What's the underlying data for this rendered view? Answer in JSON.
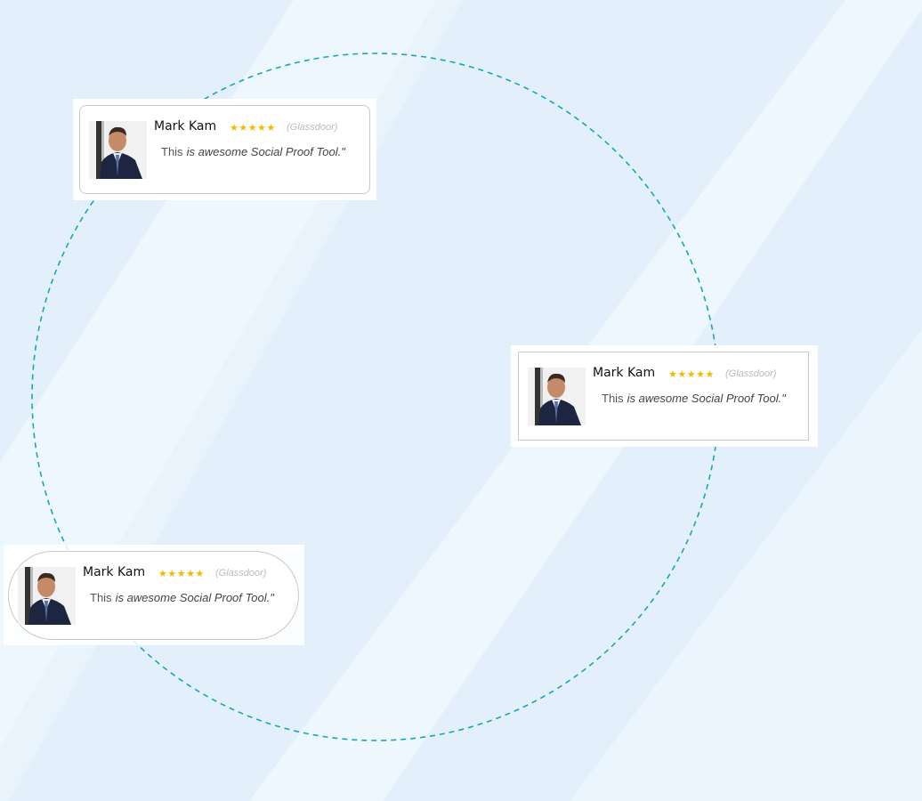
{
  "colors": {
    "background": "#e3f0fb",
    "background_stripe": "#eef7fd",
    "orbit_line": "#14a8b4",
    "star": "#f5b800",
    "source_text": "#bbbbbb"
  },
  "testimonials": [
    {
      "name": "Mark Kam",
      "stars": "★★★★★",
      "rating": 5,
      "source": "(Glassdoor)",
      "quote_lead": "This",
      "quote_rest": "is awesome Social Proof Tool.\"",
      "style": "rounded-rectangle"
    },
    {
      "name": "Mark Kam",
      "stars": "★★★★★",
      "rating": 5,
      "source": "(Glassdoor)",
      "quote_lead": "This",
      "quote_rest": "is awesome Social Proof Tool.\"",
      "style": "square-rectangle"
    },
    {
      "name": "Mark Kam",
      "stars": "★★★★★",
      "rating": 5,
      "source": "(Glassdoor)",
      "quote_lead": "This",
      "quote_rest": "is awesome Social Proof Tool.\"",
      "style": "pill"
    }
  ],
  "avatar_icon": "person-photo-icon"
}
